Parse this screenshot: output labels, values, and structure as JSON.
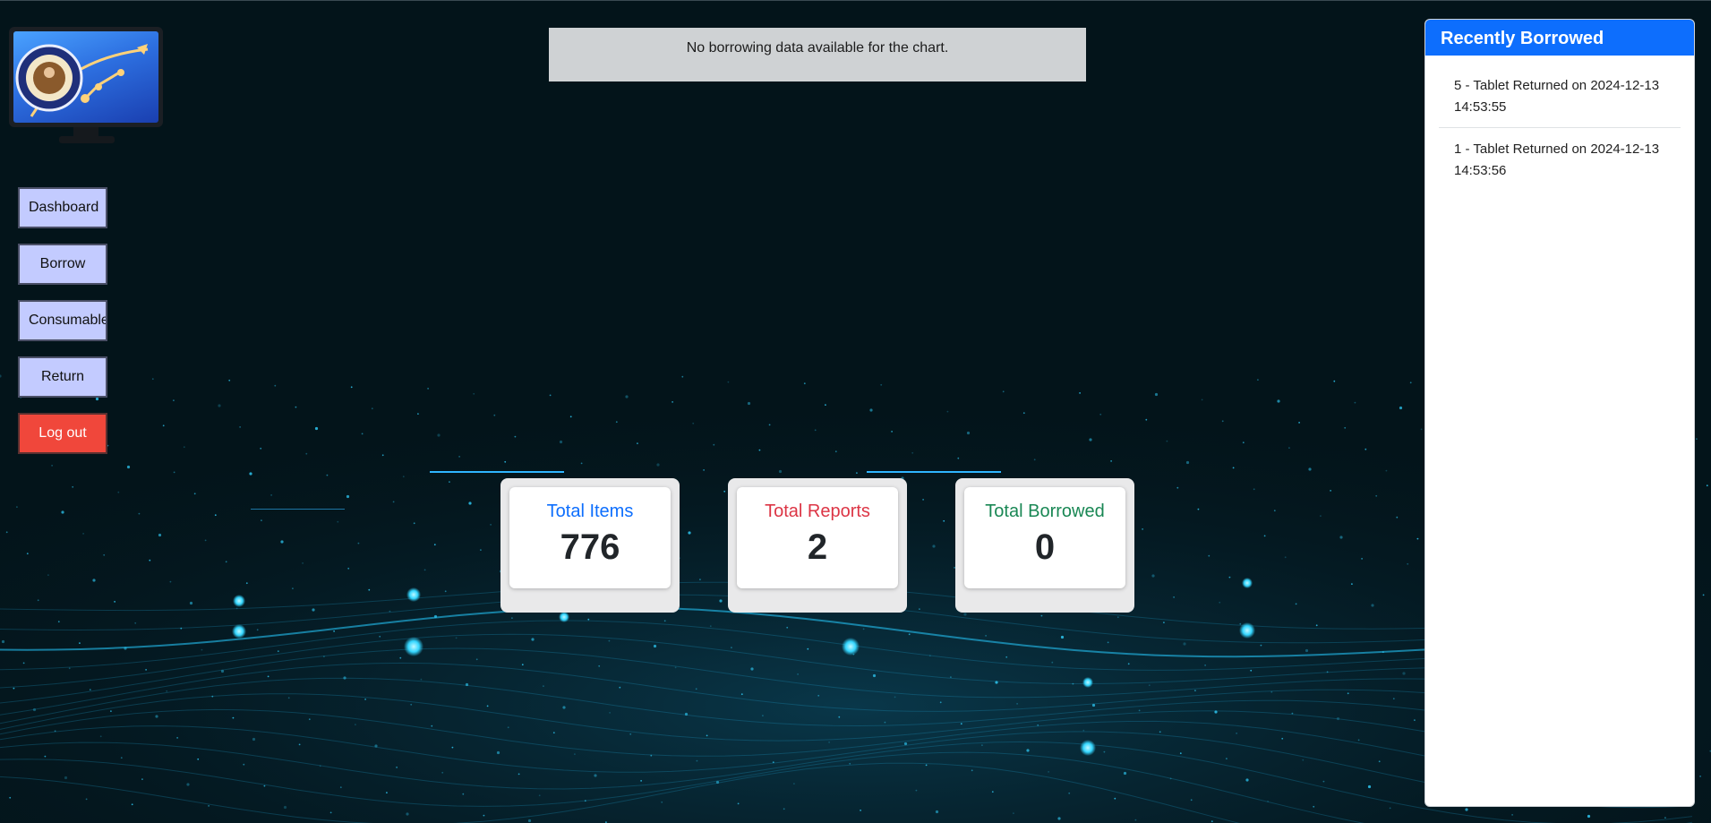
{
  "nav": {
    "dashboard": "Dashboard",
    "borrow": "Borrow",
    "consumable": "Consumable",
    "return": "Return",
    "logout": "Log out"
  },
  "chart": {
    "empty_message": "No borrowing data available for the chart."
  },
  "stats": [
    {
      "label": "Total Items",
      "value": "776",
      "color": "#0d6efd"
    },
    {
      "label": "Total Reports",
      "value": "2",
      "color": "#dc3545"
    },
    {
      "label": "Total Borrowed",
      "value": "0",
      "color": "#198754"
    }
  ],
  "recent": {
    "title": "Recently Borrowed",
    "items": [
      "5 - Tablet Returned on 2024-12-13 14:53:55",
      "1 - Tablet Returned on 2024-12-13 14:53:56"
    ]
  },
  "logo": {
    "icon": "university-seal-usb-logo"
  }
}
